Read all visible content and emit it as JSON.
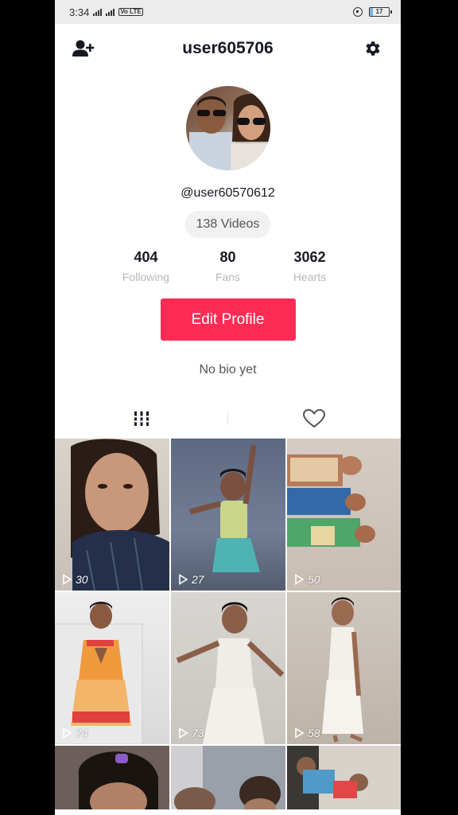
{
  "status_bar": {
    "time": "3:34",
    "volte_label": "Vo LTE",
    "battery_level": "17"
  },
  "header": {
    "title": "user605706",
    "add_friend_icon": "person-plus-icon",
    "settings_icon": "gear-icon"
  },
  "profile": {
    "handle": "@user60570612",
    "videos_label": "138 Videos",
    "stats": [
      {
        "value": "404",
        "label": "Following"
      },
      {
        "value": "80",
        "label": "Fans"
      },
      {
        "value": "3062",
        "label": "Hearts"
      }
    ],
    "edit_button": "Edit Profile",
    "bio": "No bio yet"
  },
  "tabs": [
    {
      "icon": "grid-icon",
      "active": true
    },
    {
      "icon": "heart-icon",
      "active": false
    }
  ],
  "videos": [
    {
      "views": "30"
    },
    {
      "views": "27"
    },
    {
      "views": "50"
    },
    {
      "views": "74"
    },
    {
      "views": "73"
    },
    {
      "views": "58"
    },
    {
      "views": ""
    },
    {
      "views": ""
    },
    {
      "views": ""
    }
  ],
  "colors": {
    "accent": "#fe2c55",
    "text_primary": "#161823",
    "text_muted": "#b8b8bc"
  }
}
